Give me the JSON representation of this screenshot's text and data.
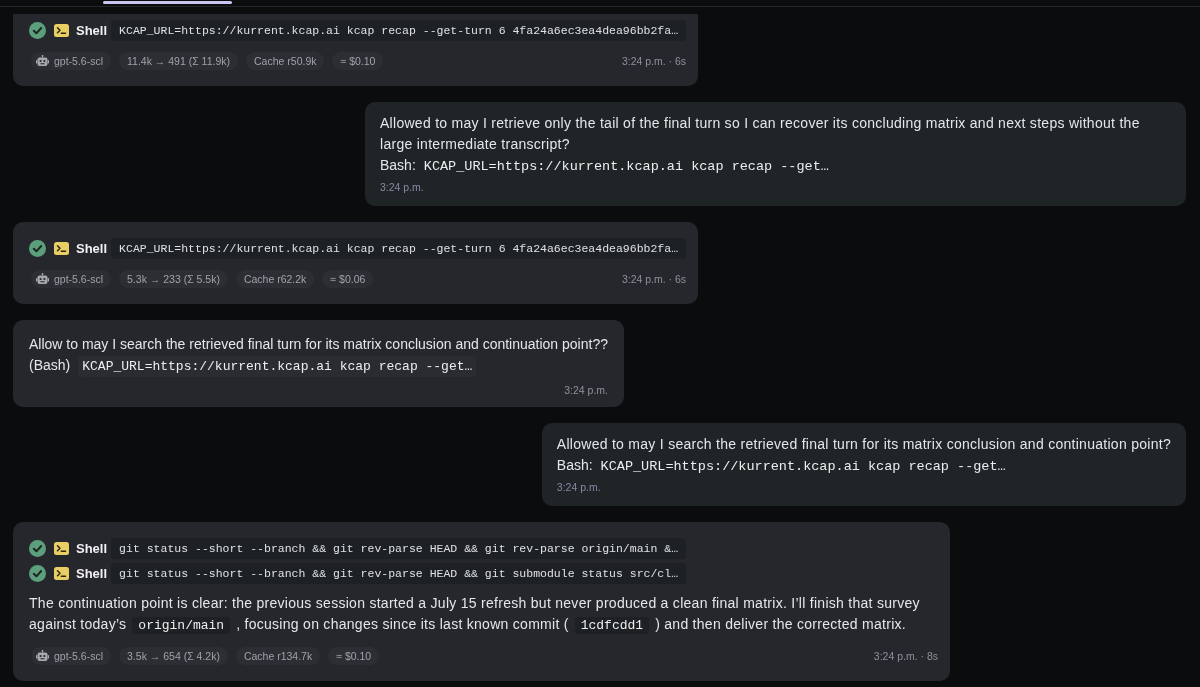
{
  "messages": [
    {
      "kind": "tool_run",
      "tool_calls": [
        {
          "tool": "Shell",
          "command": "KCAP_URL=https://kurrent.kcap.ai kcap recap --get-turn 6 4fa24a6ec3ea4dea96bb2fa…",
          "success": true
        }
      ],
      "model": "gpt-5.6-scl",
      "stats": [
        "11.4k → 491 (Σ 11.9k)",
        "Cache r50.9k",
        "≈ $0.10"
      ],
      "time": "3:24 p.m. · 6s"
    },
    {
      "kind": "user",
      "text": "Allowed to may I retrieve only the tail of the final turn so I can recover its concluding matrix and next steps without the large intermediate transcript?",
      "tool_label": "Bash:",
      "command": "KCAP_URL=https://kurrent.kcap.ai kcap recap --get…",
      "time": "3:24 p.m."
    },
    {
      "kind": "tool_run",
      "tool_calls": [
        {
          "tool": "Shell",
          "command": "KCAP_URL=https://kurrent.kcap.ai kcap recap --get-turn 6 4fa24a6ec3ea4dea96bb2fa…",
          "success": true
        }
      ],
      "model": "gpt-5.6-scl",
      "stats": [
        "5.3k → 233 (Σ 5.5k)",
        "Cache r62.2k",
        "≈ $0.06"
      ],
      "time": "3:24 p.m. · 6s"
    },
    {
      "kind": "assistant",
      "text": "Allow to may I search the retrieved final turn for its matrix conclusion and continuation point??",
      "tool_label": "(Bash)",
      "command": "KCAP_URL=https://kurrent.kcap.ai kcap recap --get…",
      "time": "3:24 p.m."
    },
    {
      "kind": "user",
      "text": "Allowed to may I search the retrieved final turn for its matrix conclusion and continuation point?",
      "tool_label": "Bash:",
      "command": "KCAP_URL=https://kurrent.kcap.ai kcap recap --get…",
      "time": "3:24 p.m."
    },
    {
      "kind": "tool_run",
      "tool_calls": [
        {
          "tool": "Shell",
          "command": "git status --short --branch && git rev-parse HEAD && git rev-parse origin/main &…",
          "success": true
        },
        {
          "tool": "Shell",
          "command": "git status --short --branch && git rev-parse HEAD && git submodule status src/cl…",
          "success": true
        }
      ],
      "text": [
        {
          "kind": "plain",
          "text": "The continuation point is clear: the previous session started a July 15 refresh but never produced a clean final matrix. I’ll finish that survey against today’s"
        },
        {
          "kind": "code",
          "text": "origin/main"
        },
        {
          "kind": "plain",
          "text": ", focusing on changes since its last known commit ("
        },
        {
          "kind": "code",
          "text": "1cdfcdd1"
        },
        {
          "kind": "plain",
          "text": ") and then deliver the corrected matrix."
        }
      ],
      "model": "gpt-5.6-scl",
      "stats": [
        "3.5k → 654 (Σ 4.2k)",
        "Cache r134.7k",
        "≈ $0.10"
      ],
      "time": "3:24 p.m. · 8s"
    }
  ]
}
